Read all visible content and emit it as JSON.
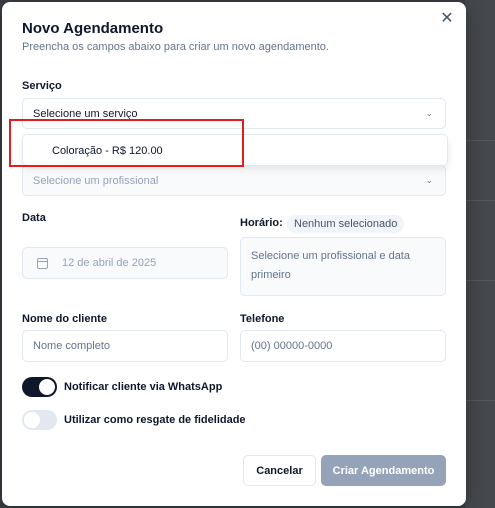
{
  "modal": {
    "title": "Novo Agendamento",
    "subtitle": "Preencha os campos abaixo para criar um novo agendamento.",
    "close_icon": "close-icon"
  },
  "service": {
    "label": "Serviço",
    "placeholder": "Selecione um serviço",
    "dropdown_option": "Coloração - R$ 120.00"
  },
  "professional": {
    "placeholder": "Selecione um profissional"
  },
  "date": {
    "label": "Data",
    "value": "12 de abril de 2025",
    "icon": "calendar-icon"
  },
  "time": {
    "label": "Horário:",
    "badge": "Nenhum selecionado",
    "hint": "Selecione um profissional e data primeiro"
  },
  "client": {
    "label": "Nome do cliente",
    "placeholder": "Nome completo"
  },
  "phone": {
    "label": "Telefone",
    "placeholder": "(00) 00000-0000"
  },
  "toggles": {
    "whatsapp_label": "Notificar cliente via WhatsApp",
    "whatsapp_on": true,
    "loyalty_label": "Utilizar como resgate de fidelidade",
    "loyalty_on": false
  },
  "actions": {
    "cancel": "Cancelar",
    "submit": "Criar Agendamento"
  },
  "colors": {
    "primary": "#0f172a",
    "disabled_button": "#94a3b8",
    "highlight": "#e11d1d"
  }
}
